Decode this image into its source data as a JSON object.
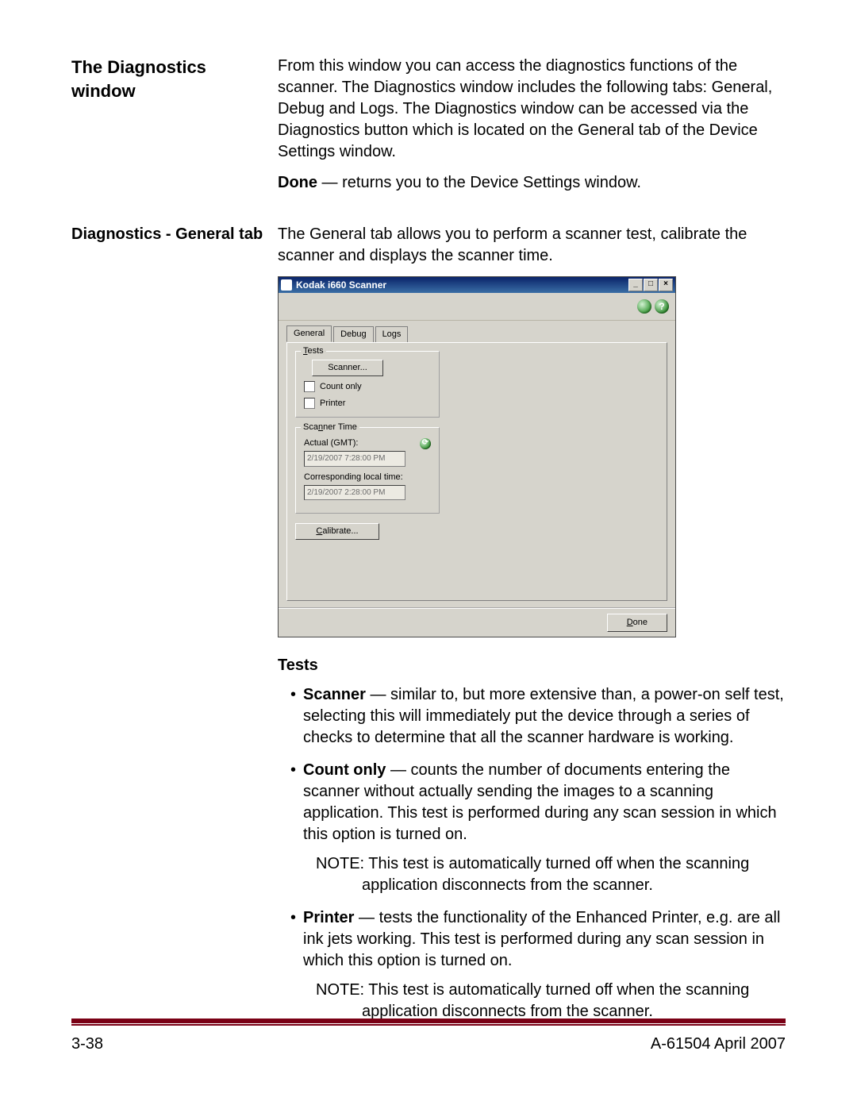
{
  "section1": {
    "heading": "The Diagnostics window",
    "intro": "From this window you can access the diagnostics functions of the scanner. The Diagnostics window includes the following tabs: General, Debug and Logs. The Diagnostics window can be accessed via the Diagnostics button which is located on the General tab of the Device Settings window.",
    "done_label": "Done",
    "done_text": " — returns you to the Device Settings window."
  },
  "section2": {
    "heading": "Diagnostics - General tab",
    "intro": "The General tab allows you to perform a scanner test, calibrate the scanner and displays the scanner time."
  },
  "screenshot": {
    "title": "Kodak i660 Scanner",
    "tabs": {
      "general": "General",
      "debug": "Debug",
      "logs": "Logs"
    },
    "tests": {
      "legend_prefix": "T",
      "legend_rest": "ests",
      "scanner_btn": "Scanner...",
      "count_only": "Count only",
      "printer": "Printer"
    },
    "time": {
      "legend_prefix": "Sca",
      "legend_u": "n",
      "legend_rest": "ner Time",
      "actual_label": "Actual (GMT):",
      "actual_value": "2/19/2007 7:28:00 PM",
      "local_label": "Corresponding local time:",
      "local_value": "2/19/2007 2:28:00 PM"
    },
    "calibrate_u": "C",
    "calibrate_rest": "alibrate...",
    "done_u": "D",
    "done_rest": "one"
  },
  "tests_section": {
    "heading": "Tests",
    "scanner_label": "Scanner",
    "scanner_text": " — similar to, but more extensive than, a power-on self test, selecting this will immediately put the device through a series of checks to determine that all the scanner hardware is working.",
    "count_label": "Count only",
    "count_text": " — counts the number of documents entering the scanner without actually sending the images to a scanning application. This test is performed during any scan session in which this option is turned on.",
    "count_note": "NOTE: This test is automatically turned off when the scanning application disconnects from the scanner.",
    "printer_label": "Printer",
    "printer_text": " — tests the functionality of the Enhanced Printer, e.g. are all ink jets working. This test is performed during any scan session in which this option is turned on.",
    "printer_note": "NOTE: This test is automatically turned off when the scanning application disconnects from the scanner."
  },
  "footer": {
    "left": "3-38",
    "right": "A-61504  April 2007"
  }
}
